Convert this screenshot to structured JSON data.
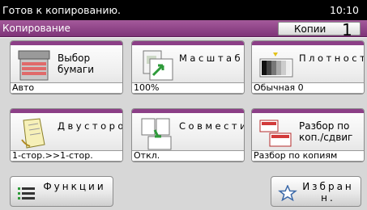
{
  "status": {
    "message": "Готов к копированию.",
    "time": "10:10"
  },
  "header": {
    "title": "Копирование",
    "copies_label": "Копии",
    "copies_count": "1"
  },
  "tiles": [
    {
      "label": "Выбор бумаги",
      "value": "Авто"
    },
    {
      "label": "Масштаб",
      "value": "100%"
    },
    {
      "label": "Плотность",
      "value": "Обычная 0"
    },
    {
      "label": "Двусторонняя",
      "value": "1-стор.>>1-стор."
    },
    {
      "label": "Совместить",
      "value": "Откл."
    },
    {
      "label": "Разбор по коп./сдвиг",
      "value": "Разбор по копиям"
    }
  ],
  "bottom": {
    "functions_label": "Функции",
    "favorites_label": "Избран н."
  },
  "colors": {
    "accent": "#8c3f87",
    "header": "#a45a9b"
  }
}
